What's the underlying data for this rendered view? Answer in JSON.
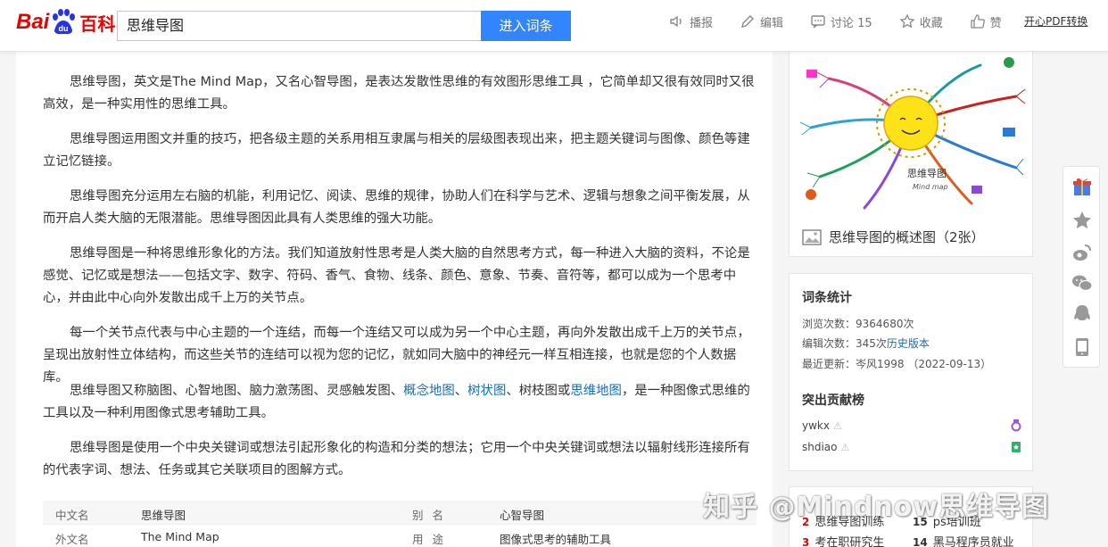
{
  "header": {
    "logo_text_left": "Bai",
    "logo_text_right": "百科",
    "search_value": "思维导图",
    "search_button": "进入词条",
    "tools": [
      {
        "icon": "speaker-icon",
        "label": "播报"
      },
      {
        "icon": "edit-icon",
        "label": "编辑"
      },
      {
        "icon": "comment-icon",
        "label": "讨论 15"
      },
      {
        "icon": "star-icon",
        "label": "收藏"
      },
      {
        "icon": "thumbs-up-icon",
        "label": "赞"
      }
    ],
    "pdf_link": "开心PDF转换"
  },
  "article": {
    "paragraphs": [
      "思维导图，英文是The Mind Map，又名心智导图，是表达发散性思维的有效图形思维工具 ，它简单却又很有效同时又很高效，是一种实用性的思维工具。",
      "思维导图运用图文并重的技巧，把各级主题的关系用相互隶属与相关的层级图表现出来，把主题关键词与图像、颜色等建立记忆链接。",
      "思维导图充分运用左右脑的机能，利用记忆、阅读、思维的规律，协助人们在科学与艺术、逻辑与想象之间平衡发展，从而开启人类大脑的无限潜能。思维导图因此具有人类思维的强大功能。",
      "思维导图是一种将思维形象化的方法。我们知道放射性思考是人类大脑的自然思考方式，每一种进入大脑的资料，不论是感觉、记忆或是想法——包括文字、数字、符码、香气、食物、线条、颜色、意象、节奏、音符等，都可以成为一个思考中心，并由此中心向外发散出成千上万的关节点。",
      "每一个关节点代表与中心主题的一个连结，而每一个连结又可以成为另一个中心主题，再向外发散出成千上万的关节点，呈现出放射性立体结构，而这些关节的连结可以视为您的记忆，就如同大脑中的神经元一样互相连接，也就是您的个人数据库。"
    ],
    "para6": {
      "prefix": "思维导图又称脑图、心智地图、脑力激荡图、灵感触发图、",
      "link1": "概念地图",
      "sep1": "、",
      "link2": "树状图",
      "middle": "、树枝图或",
      "link3": "思维地图",
      "suffix": "，是一种图像式思维的工具以及一种利用图像式思考辅助工具。"
    },
    "para7": "思维导图是使用一个中央关键词或想法引起形象化的构造和分类的想法；它用一个中央关键词或想法以辐射线形连接所有的代表字词、想法、任务或其它关联项目的图解方式。"
  },
  "infobox": {
    "rows": [
      {
        "k1": "中文名",
        "v1": "思维导图",
        "k2": "别名",
        "v2": "心智导图"
      },
      {
        "k1": "外文名",
        "v1": "The Mind Map",
        "k2": "用途",
        "v2": "图像式思考的辅助工具"
      }
    ]
  },
  "album": {
    "caption": "思维导图的概述图（2张）",
    "image_title": "思维导图",
    "image_subtitle": "Mind map"
  },
  "stats": {
    "title": "词条统计",
    "views_label": "浏览次数：",
    "views_value": "9364680次",
    "edits_label": "编辑次数：",
    "edits_value": "345次",
    "history_link": "历史版本",
    "updated_label": "最近更新：",
    "updated_value": "岑风1998 （2022-09-13）",
    "contrib_title": "突出贡献榜",
    "contributors": [
      "ywkx",
      "shdiao"
    ]
  },
  "related": {
    "items": [
      {
        "num": "2",
        "text": "思维导图训练"
      },
      {
        "num": "15",
        "text": "ps培训班"
      },
      {
        "num": "3",
        "text": "考在职研究生"
      },
      {
        "num": "14",
        "text": "黑马程序员就业"
      }
    ]
  },
  "watermark": "知乎 @Mindnow思维导图",
  "colors": {
    "brand_red": "#e10602",
    "search_blue": "#3385ff",
    "link_blue": "#136ec2"
  }
}
